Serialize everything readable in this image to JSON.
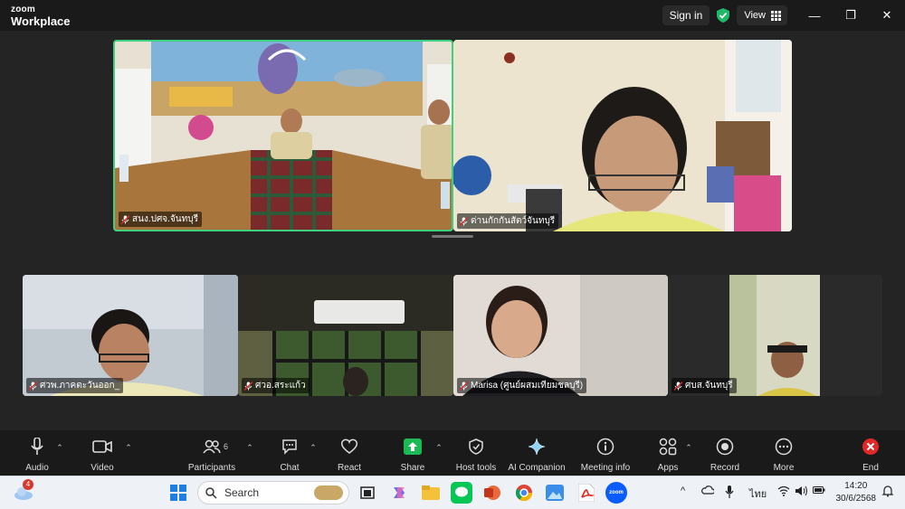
{
  "app": {
    "brand_top": "zoom",
    "brand_bottom": "Workplace",
    "sign_in_label": "Sign in",
    "view_label": "View"
  },
  "window_controls": {
    "minimize": "—",
    "restore": "❐",
    "close": "✕"
  },
  "participants_tiles": [
    {
      "name": "สนง.ปศจ.จันทบุรี",
      "muted": true,
      "active_speaker": true
    },
    {
      "name": "ด่านกักกันสัตว์จันทบุรี",
      "muted": true,
      "active_speaker": false
    },
    {
      "name": "ศวพ.ภาคตะวันออก_",
      "muted": true,
      "active_speaker": false
    },
    {
      "name": "ศวอ.สระแก้ว",
      "muted": true,
      "active_speaker": false
    },
    {
      "name": "Marisa (ศูนย์ผสมเทียมชลบุรี)",
      "muted": true,
      "active_speaker": false
    },
    {
      "name": "ศบส.จันทบุรี",
      "muted": true,
      "active_speaker": false
    }
  ],
  "toolbar": {
    "audio": "Audio",
    "video": "Video",
    "participants": "Participants",
    "participants_count": "6",
    "chat": "Chat",
    "react": "React",
    "share": "Share",
    "host_tools": "Host tools",
    "ai_companion": "AI Companion",
    "meeting_info": "Meeting info",
    "apps": "Apps",
    "record": "Record",
    "more": "More",
    "end": "End"
  },
  "taskbar": {
    "weather_badge": "4",
    "search_placeholder": "Search",
    "ime_label": "ไทย",
    "time": "14:20",
    "date": "30/6/2568"
  },
  "colors": {
    "active_border": "#3ed07f",
    "share_green": "#1db954",
    "end_red": "#e02828",
    "shield_green": "#1fb866"
  }
}
